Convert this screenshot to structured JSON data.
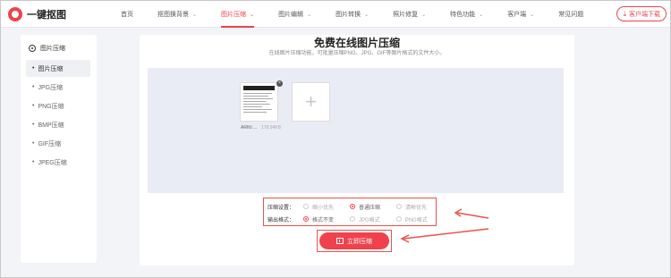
{
  "brand": {
    "name": "一键抠图",
    "accent": "#f0424c"
  },
  "nav": {
    "items": [
      {
        "label": "首页",
        "dropdown": false
      },
      {
        "label": "抠图换背景",
        "dropdown": true
      },
      {
        "label": "图片压缩",
        "dropdown": true,
        "active": true
      },
      {
        "label": "图片编辑",
        "dropdown": true
      },
      {
        "label": "图片转换",
        "dropdown": true
      },
      {
        "label": "照片修复",
        "dropdown": true
      },
      {
        "label": "特色功能",
        "dropdown": true
      },
      {
        "label": "客户端",
        "dropdown": true
      },
      {
        "label": "常见问题",
        "dropdown": false
      }
    ],
    "client_button": "客户端下载"
  },
  "sidebar": {
    "heading": "图片压缩",
    "items": [
      {
        "label": "图片压缩",
        "active": true
      },
      {
        "label": "JPG压缩"
      },
      {
        "label": "PNG压缩"
      },
      {
        "label": "BMP压缩"
      },
      {
        "label": "GIF压缩"
      },
      {
        "label": "JPEG压缩"
      }
    ]
  },
  "main": {
    "title": "免费在线图片压缩",
    "subtitle": "在线图片压缩功能，可批量压缩PNG、JPG、GIF等图片格式的文件大小。",
    "file": {
      "name": "ARKit ...",
      "size": "178.94KB"
    },
    "add_glyph": "+",
    "close_glyph": "×"
  },
  "options": {
    "compress_label": "压缩设置：",
    "compress_choices": [
      {
        "label": "缩小优先",
        "selected": false
      },
      {
        "label": "普通压缩",
        "selected": true
      },
      {
        "label": "清晰优先",
        "selected": false
      }
    ],
    "format_label": "输出格式：",
    "format_choices": [
      {
        "label": "格式不变",
        "selected": true
      },
      {
        "label": "JPG格式",
        "selected": false
      },
      {
        "label": "PNG格式",
        "selected": false
      }
    ]
  },
  "action": {
    "compress_button": "立即压缩"
  }
}
